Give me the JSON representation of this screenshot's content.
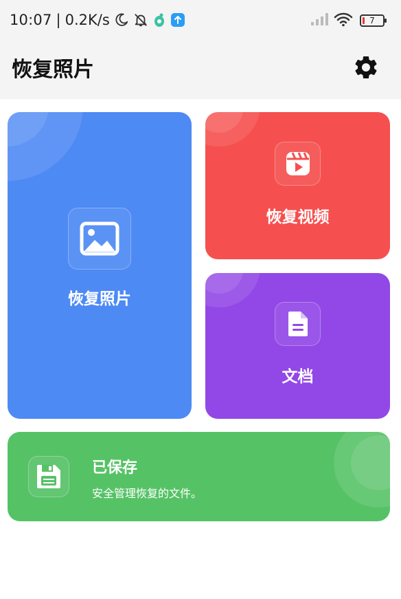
{
  "status_bar": {
    "time": "10:07",
    "separator": "|",
    "net_speed": "0.2K/s",
    "battery_level": "7",
    "icons": [
      "moon-icon",
      "bell-off-icon",
      "app-notification-icon",
      "upload-notification-icon",
      "signal-icon",
      "wifi-icon",
      "battery-icon"
    ]
  },
  "app_bar": {
    "title": "恢复照片",
    "settings_icon": "gear-icon"
  },
  "cards": {
    "photo": {
      "label": "恢复照片",
      "icon": "image-icon",
      "color": "#4e8af4"
    },
    "video": {
      "label": "恢复视频",
      "icon": "video-reel-icon",
      "color": "#f5504f"
    },
    "document": {
      "label": "文档",
      "icon": "document-icon",
      "color": "#9248e6"
    },
    "saved": {
      "title": "已保存",
      "subtitle": "安全管理恢复的文件。",
      "icon": "floppy-disk-icon",
      "color": "#56c266"
    }
  }
}
